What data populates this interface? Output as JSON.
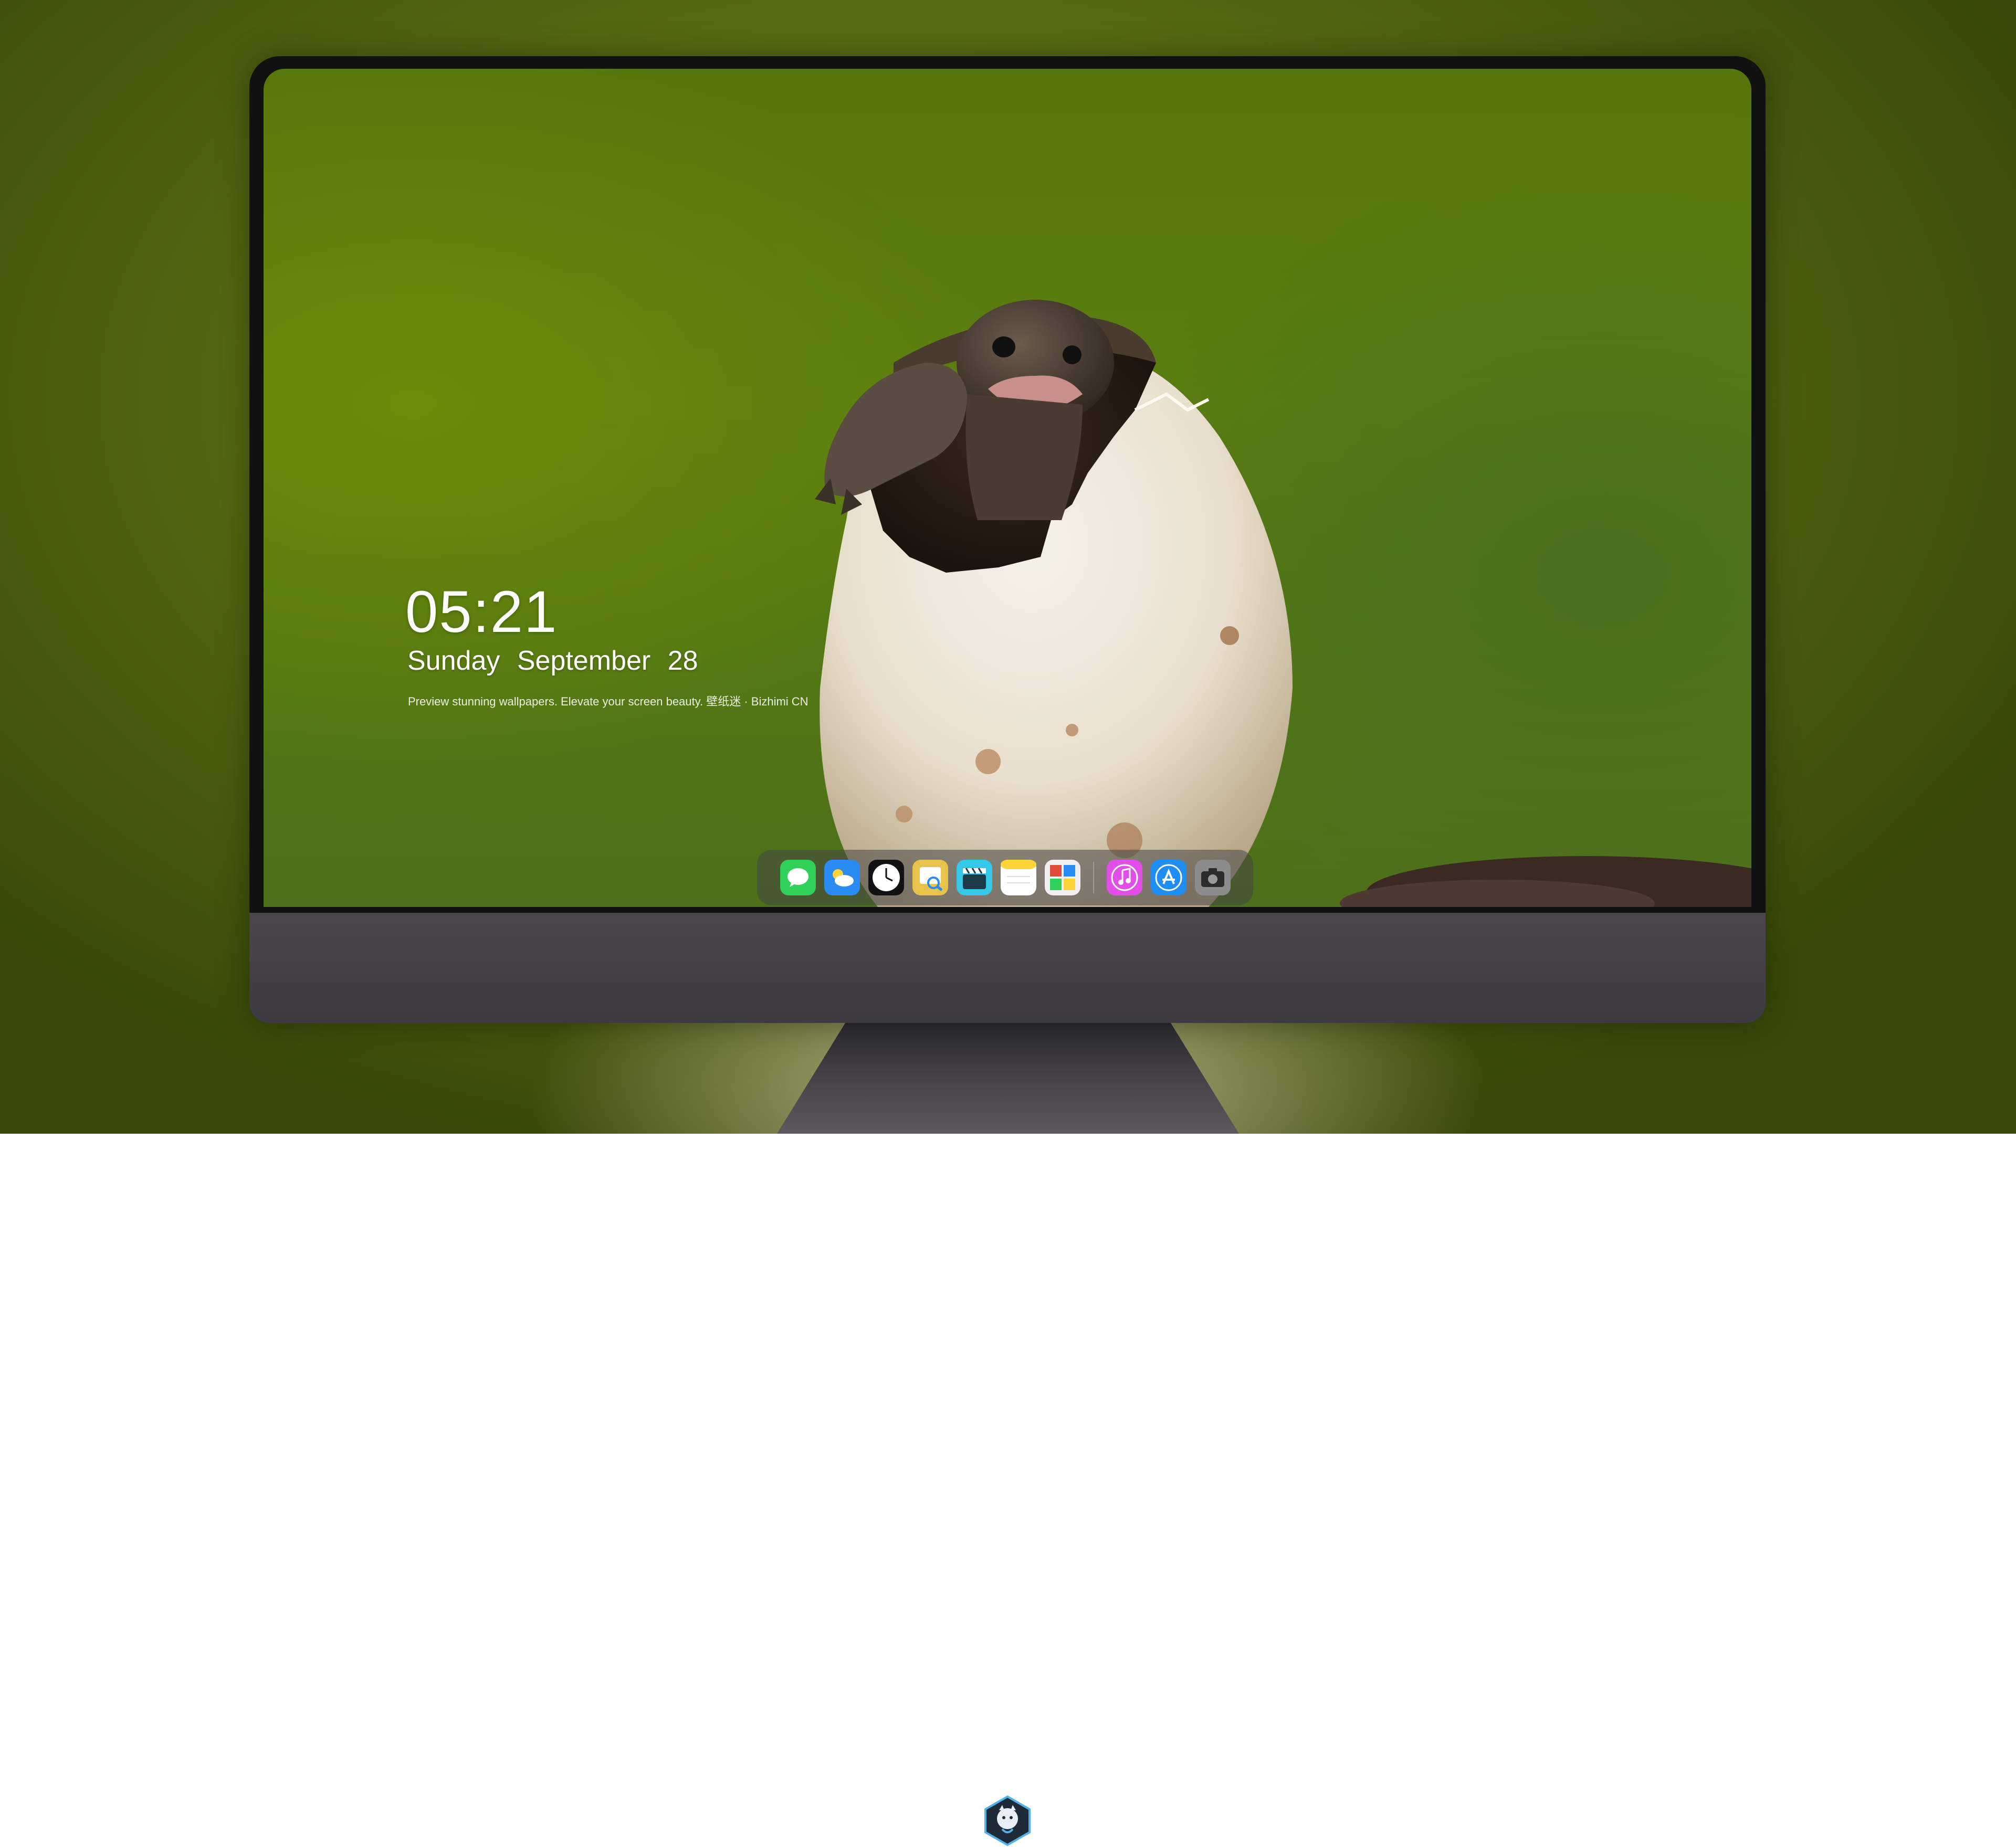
{
  "lockscreen": {
    "time": "05:21",
    "weekday": "Sunday",
    "month": "September",
    "day": "28",
    "tagline": "Preview stunning wallpapers. Elevate your screen beauty. 壁纸迷 · Bizhimi CN"
  },
  "dock": {
    "apps": [
      {
        "name": "Messages",
        "icon": "messages-icon",
        "color": "#2fd158"
      },
      {
        "name": "Weather",
        "icon": "weather-icon",
        "color": "#2a8cf2"
      },
      {
        "name": "Clock",
        "icon": "clock-icon",
        "color": "#111111"
      },
      {
        "name": "Preview",
        "icon": "preview-icon",
        "color": "#e8c24a"
      },
      {
        "name": "Clips",
        "icon": "clapperboard-icon",
        "color": "#35c7e8"
      },
      {
        "name": "Notes",
        "icon": "notes-icon",
        "color": "#ffd43b"
      },
      {
        "name": "Photo Booth",
        "icon": "photo-booth-icon",
        "color": "#f0f0f0"
      },
      {
        "name": "iTunes",
        "icon": "music-icon",
        "color": "#e24ee8"
      },
      {
        "name": "App Store",
        "icon": "app-store-icon",
        "color": "#1e8ef5"
      },
      {
        "name": "Screenshot",
        "icon": "camera-icon",
        "color": "#8c8c8c"
      }
    ]
  },
  "colors": {
    "background": "#56760c",
    "monitor_chin": "#46424a",
    "text": "#ffffff"
  }
}
